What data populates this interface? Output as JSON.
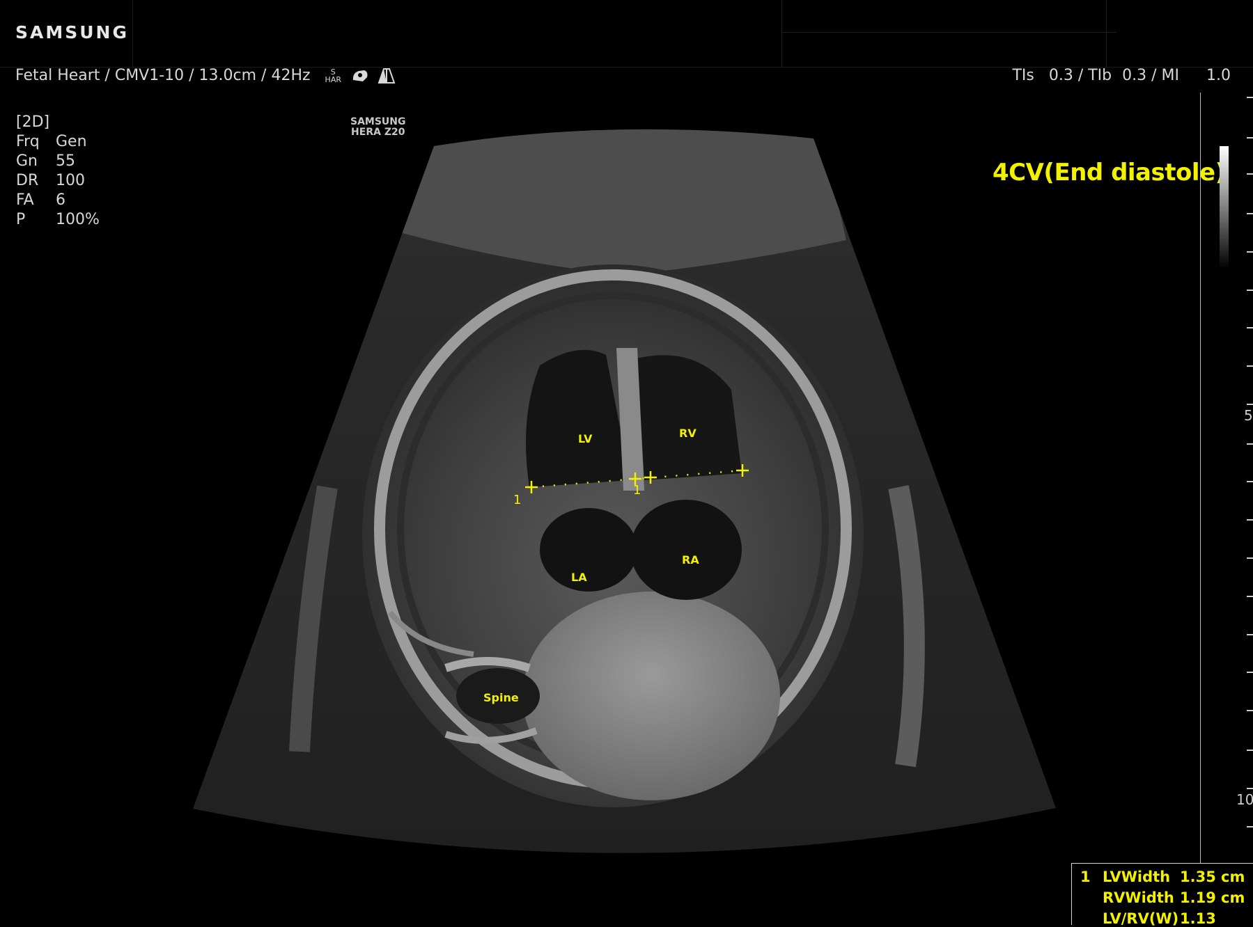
{
  "header": {
    "brand": "SAMSUNG",
    "exam_info": "Fetal Heart / CMV1-10 / 13.0cm / 42Hz",
    "har_top": "S",
    "har_bottom": "HAR",
    "safety": {
      "tis_label": "TIs",
      "tis_value": "0.3 / TIb",
      "tib_value": "0.3 / MI",
      "mi_value": "1.0"
    }
  },
  "params": {
    "mode": "[2D]",
    "rows": [
      {
        "key": "Frq",
        "value": "Gen"
      },
      {
        "key": "Gn",
        "value": "55"
      },
      {
        "key": "DR",
        "value": "100"
      },
      {
        "key": "FA",
        "value": "6"
      },
      {
        "key": "P",
        "value": "100%"
      }
    ]
  },
  "watermark": {
    "line1": "SAMSUNG",
    "line2": "HERA Z20"
  },
  "view_label": "4CV(End diastole)",
  "anatomy": {
    "lv": "LV",
    "rv": "RV",
    "la": "LA",
    "ra": "RA",
    "spine": "Spine"
  },
  "caliper": {
    "label_a": "1",
    "label_b": "1"
  },
  "depth_scale": {
    "mark_5": "5",
    "mark_10": "10"
  },
  "measurements": [
    {
      "index": "1",
      "label": "LVWidth",
      "value": "1.35",
      "unit": "cm"
    },
    {
      "index": "",
      "label": "RVWidth",
      "value": "1.19",
      "unit": "cm"
    },
    {
      "index": "",
      "label": "LV/RV(W)",
      "value": "1.13",
      "unit": ""
    }
  ],
  "colors": {
    "annotation_yellow": "#f2f200",
    "overlay_text": "#d8d8d8"
  },
  "icons": [
    "probe-icon",
    "sector-icon"
  ]
}
